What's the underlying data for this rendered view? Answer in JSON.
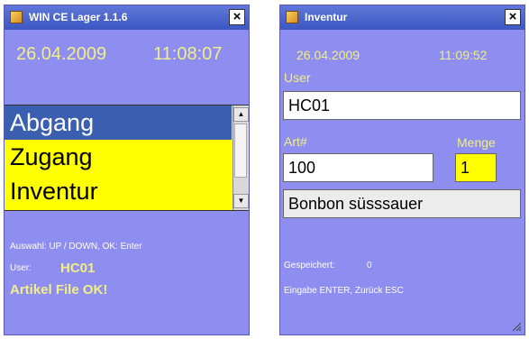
{
  "window1": {
    "title": "WIN CE Lager 1.1.6",
    "date": "26.04.2009",
    "time": "11:08:07",
    "menu_items": [
      "Abgang",
      "Zugang",
      "Inventur"
    ],
    "help_text": "Auswahl: UP / DOWN, OK: Enter",
    "user_label": "User:",
    "user_value": "HC01",
    "status": "Artikel File OK!"
  },
  "window2": {
    "title": "Inventur",
    "date": "26.04.2009",
    "time": "11:09:52",
    "user_label": "User",
    "user_value": "HC01",
    "art_label": "Art#",
    "art_value": "100",
    "menge_label": "Menge",
    "menge_value": "1",
    "product_name": "Bonbon süsssauer",
    "saved_label": "Gespeichert:",
    "saved_value": "0",
    "help_text": "Eingabe ENTER, Zurück ESC"
  },
  "colors": {
    "window_bg": "#8e8ef0",
    "titlebar": "#3b57c2",
    "accent_text": "#f2ee88",
    "list_bg": "#ffff00",
    "selected_bg": "#3a5fb0"
  }
}
